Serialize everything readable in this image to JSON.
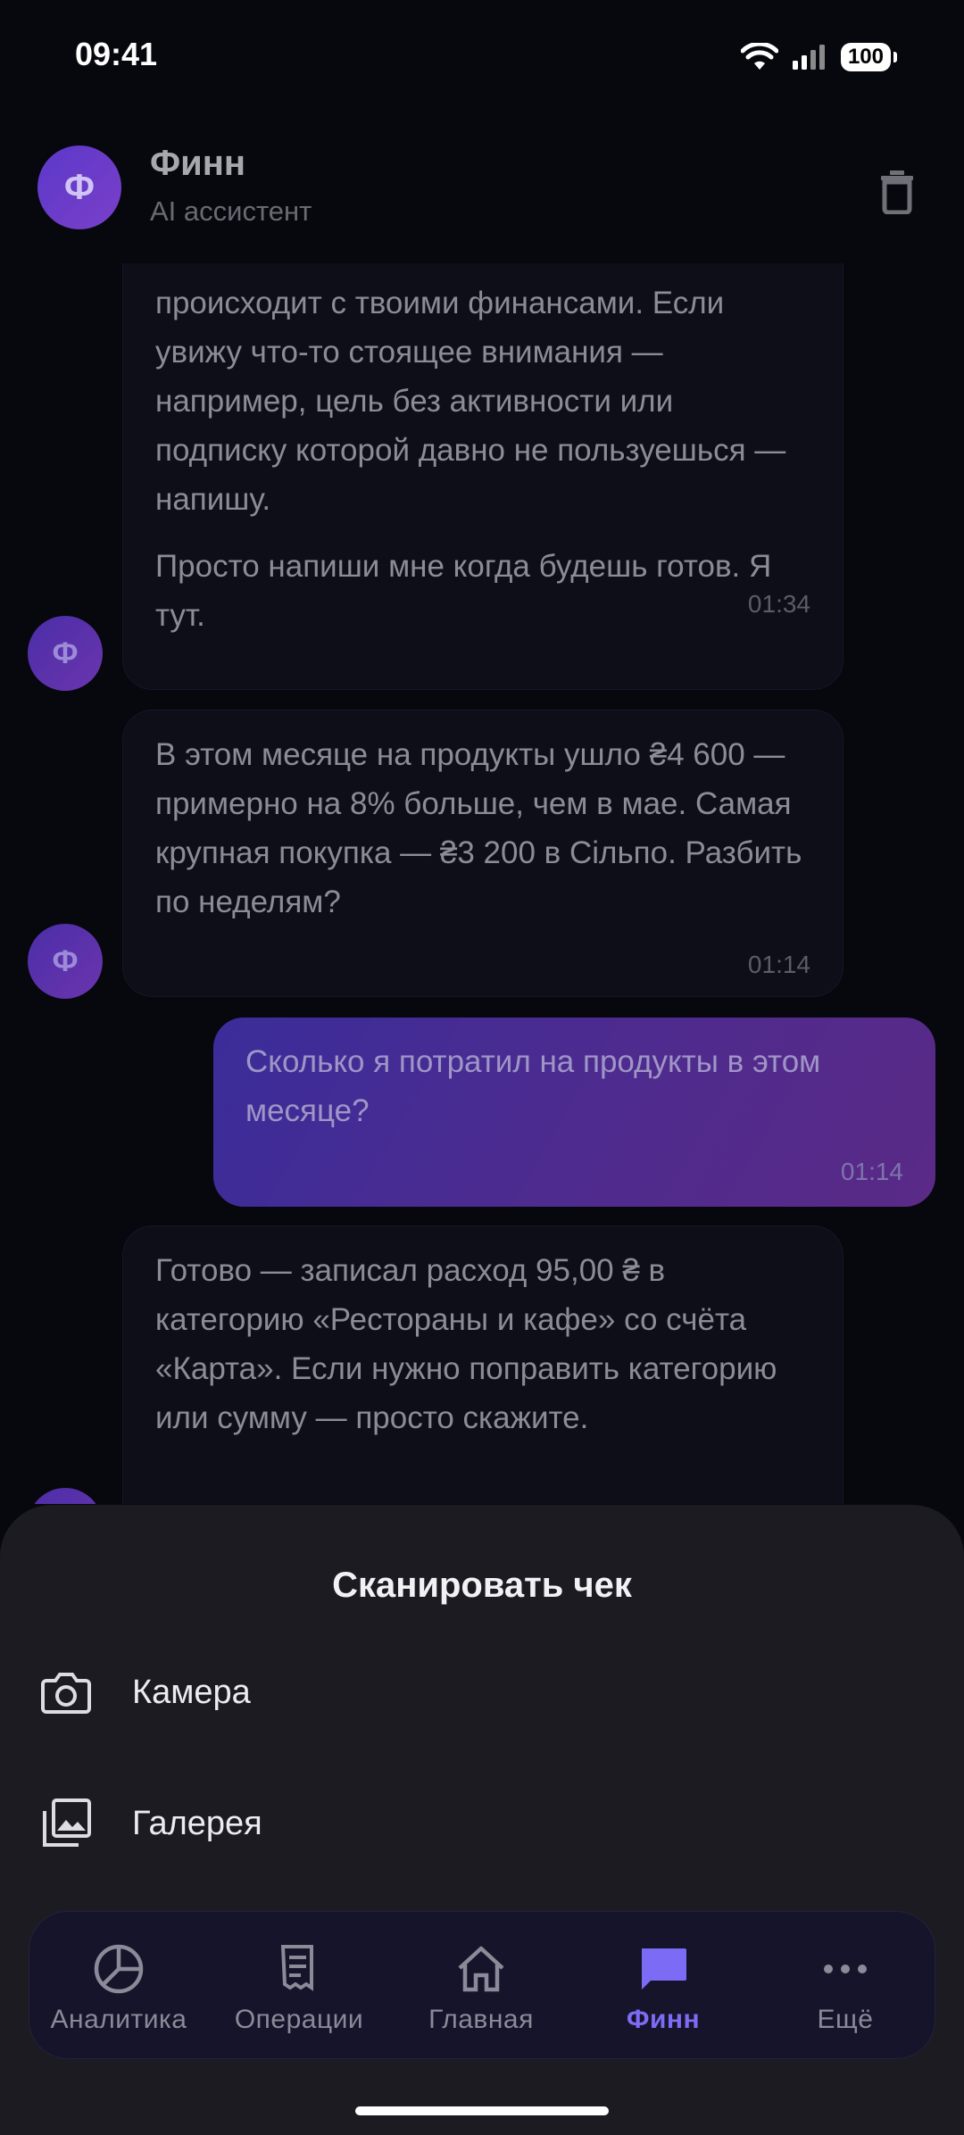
{
  "status_bar": {
    "time": "09:41",
    "battery": "100"
  },
  "header": {
    "avatar_letter": "Ф",
    "title": "Финн",
    "subtitle": "AI ассистент"
  },
  "messages": [
    {
      "role": "bot",
      "paragraphs": [
        "происходит с твоими финансами. Если увижу что-то стоящее внимания — например, цель без активности или подписку которой давно не пользуешься — напишу.",
        "Просто напиши мне когда будешь готов. Я тут."
      ],
      "time": "01:34",
      "avatar_letter": "Ф"
    },
    {
      "role": "bot",
      "paragraphs": [
        "В этом месяце на продукты ушло ₴4 600 — примерно на 8% больше, чем в мае. Самая крупная покупка — ₴3 200 в Сільпо. Разбить по неделям?"
      ],
      "time": "01:14",
      "avatar_letter": "Ф"
    },
    {
      "role": "user",
      "paragraphs": [
        "Сколько я потратил на продукты в этом месяце?"
      ],
      "time": "01:14"
    },
    {
      "role": "bot",
      "paragraphs": [
        "Готово — записал расход 95,00 ₴ в категорию «Рестораны и кафе» со счёта «Карта». Если нужно поправить категорию или сумму — просто скажите."
      ],
      "avatar_letter": "Ф"
    }
  ],
  "sheet": {
    "title": "Сканировать чек",
    "options": [
      {
        "label": "Камера",
        "icon": "camera-icon"
      },
      {
        "label": "Галерея",
        "icon": "gallery-icon"
      }
    ]
  },
  "nav": {
    "active": "Финн",
    "accent_color": "#7c6cf5",
    "items": [
      {
        "label": "Аналитика",
        "icon": "pie-chart-icon"
      },
      {
        "label": "Операции",
        "icon": "receipt-icon"
      },
      {
        "label": "Главная",
        "icon": "home-icon"
      },
      {
        "label": "Финн",
        "icon": "chat-icon"
      },
      {
        "label": "Ещё",
        "icon": "more-icon"
      }
    ]
  }
}
